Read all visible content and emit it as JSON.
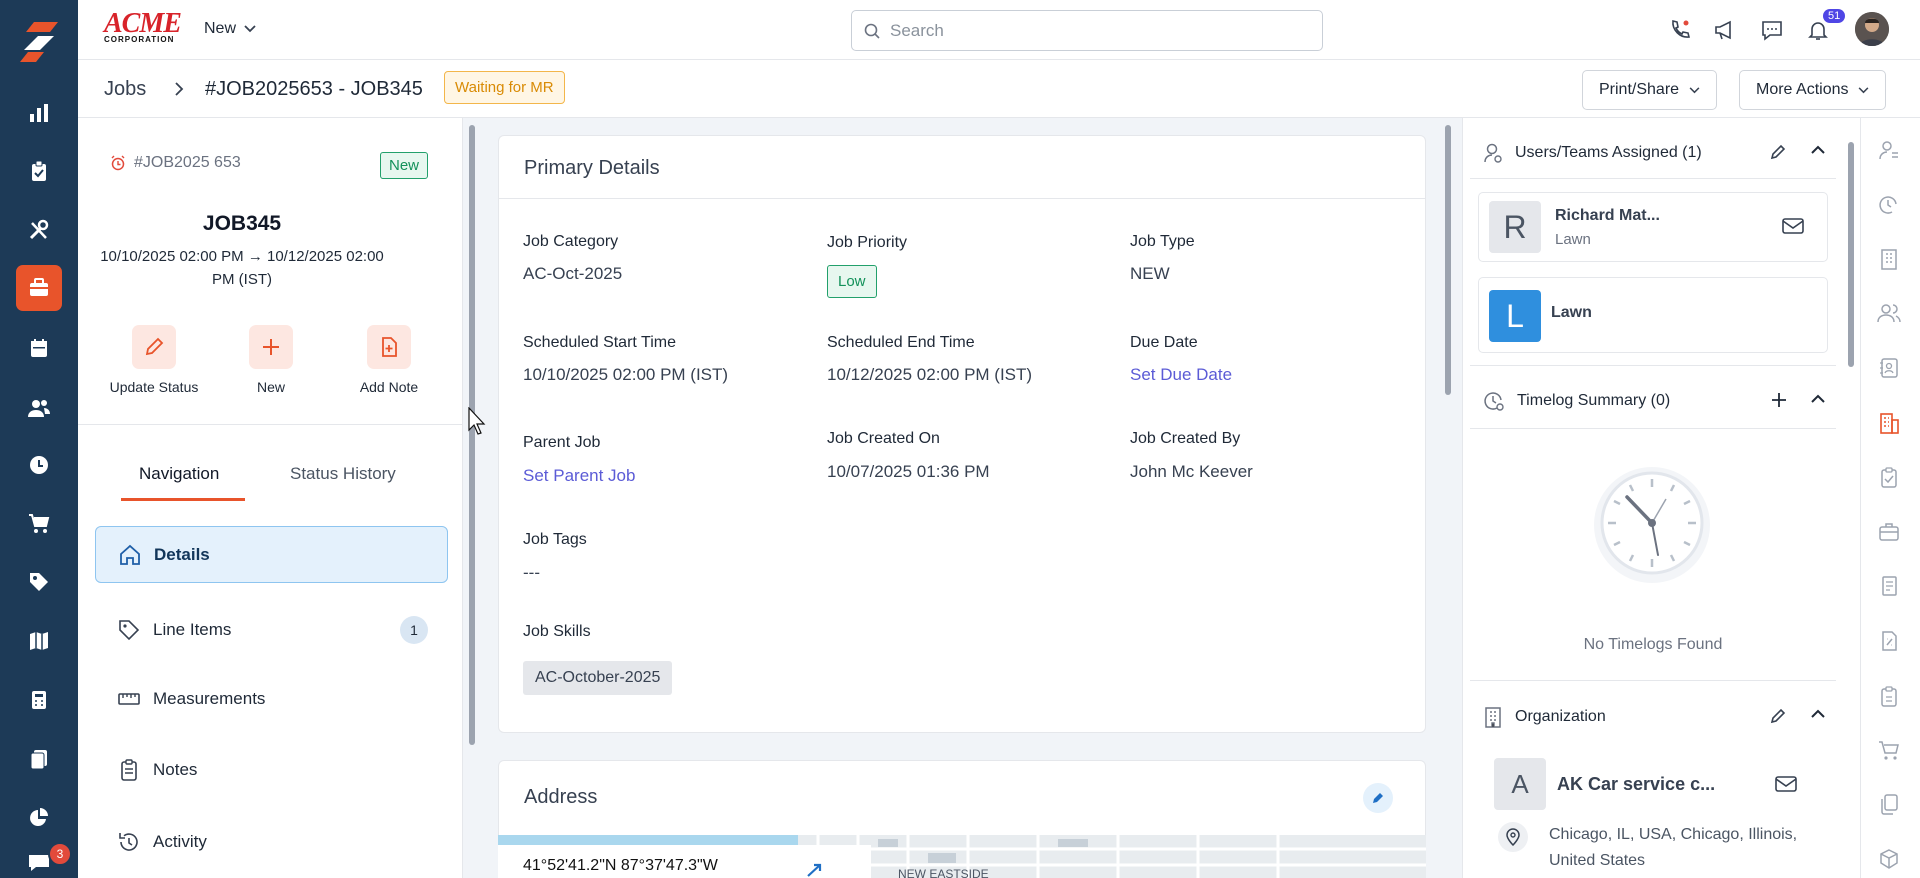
{
  "brand": {
    "name": "ACME",
    "subtitle": "CORPORATION"
  },
  "topbar": {
    "new_label": "New",
    "search_placeholder": "Search",
    "notification_count": "51"
  },
  "rail": {
    "chat_badge": "3"
  },
  "breadcrumb": {
    "root": "Jobs",
    "current": "#JOB2025653 - JOB345",
    "status": "Waiting for MR"
  },
  "header_actions": {
    "print_share": "Print/Share",
    "more_actions": "More Actions"
  },
  "job_summary": {
    "id": "#JOB2025 653",
    "badge": "New",
    "title": "JOB345",
    "dates": "10/10/2025 02:00 PM → 10/12/2025 02:00 PM (IST)"
  },
  "quick_actions": {
    "update_status": "Update Status",
    "new": "New",
    "add_note": "Add Note"
  },
  "tabs": {
    "navigation": "Navigation",
    "status_history": "Status History"
  },
  "nav": {
    "details": "Details",
    "line_items": "Line Items",
    "line_items_count": "1",
    "measurements": "Measurements",
    "notes": "Notes",
    "activity": "Activity"
  },
  "primary_details": {
    "title": "Primary Details",
    "job_category_label": "Job Category",
    "job_category": "AC-Oct-2025",
    "job_priority_label": "Job Priority",
    "job_priority": "Low",
    "job_type_label": "Job Type",
    "job_type": "NEW",
    "start_label": "Scheduled Start Time",
    "start": "10/10/2025 02:00 PM (IST)",
    "end_label": "Scheduled End Time",
    "end": "10/12/2025 02:00 PM (IST)",
    "due_label": "Due Date",
    "due": "Set Due Date",
    "parent_label": "Parent Job",
    "parent": "Set Parent Job",
    "created_on_label": "Job Created On",
    "created_on": "10/07/2025 01:36 PM",
    "created_by_label": "Job Created By",
    "created_by": "John Mc Keever",
    "tags_label": "Job Tags",
    "tags": "---",
    "skills_label": "Job Skills",
    "skill": "AC-October-2025"
  },
  "address": {
    "title": "Address",
    "coords": "41°52'41.2\"N 87°37'47.3\"W",
    "map_label": "NEW EASTSIDE"
  },
  "assigned": {
    "title": "Users/Teams Assigned (1)",
    "user_initial": "R",
    "user_name": "Richard Mat...",
    "user_team": "Lawn",
    "team_initial": "L",
    "team_name": "Lawn"
  },
  "timelog": {
    "title": "Timelog Summary (0)",
    "empty": "No Timelogs Found"
  },
  "organization": {
    "title": "Organization",
    "initial": "A",
    "name": "AK Car service c...",
    "location": "Chicago, IL, USA, Chicago, Illinois, United States"
  },
  "colors": {
    "accent": "#e8542b",
    "rail": "#1d3a57",
    "link": "#5b5bd6",
    "team_blue": "#2f8fde"
  }
}
